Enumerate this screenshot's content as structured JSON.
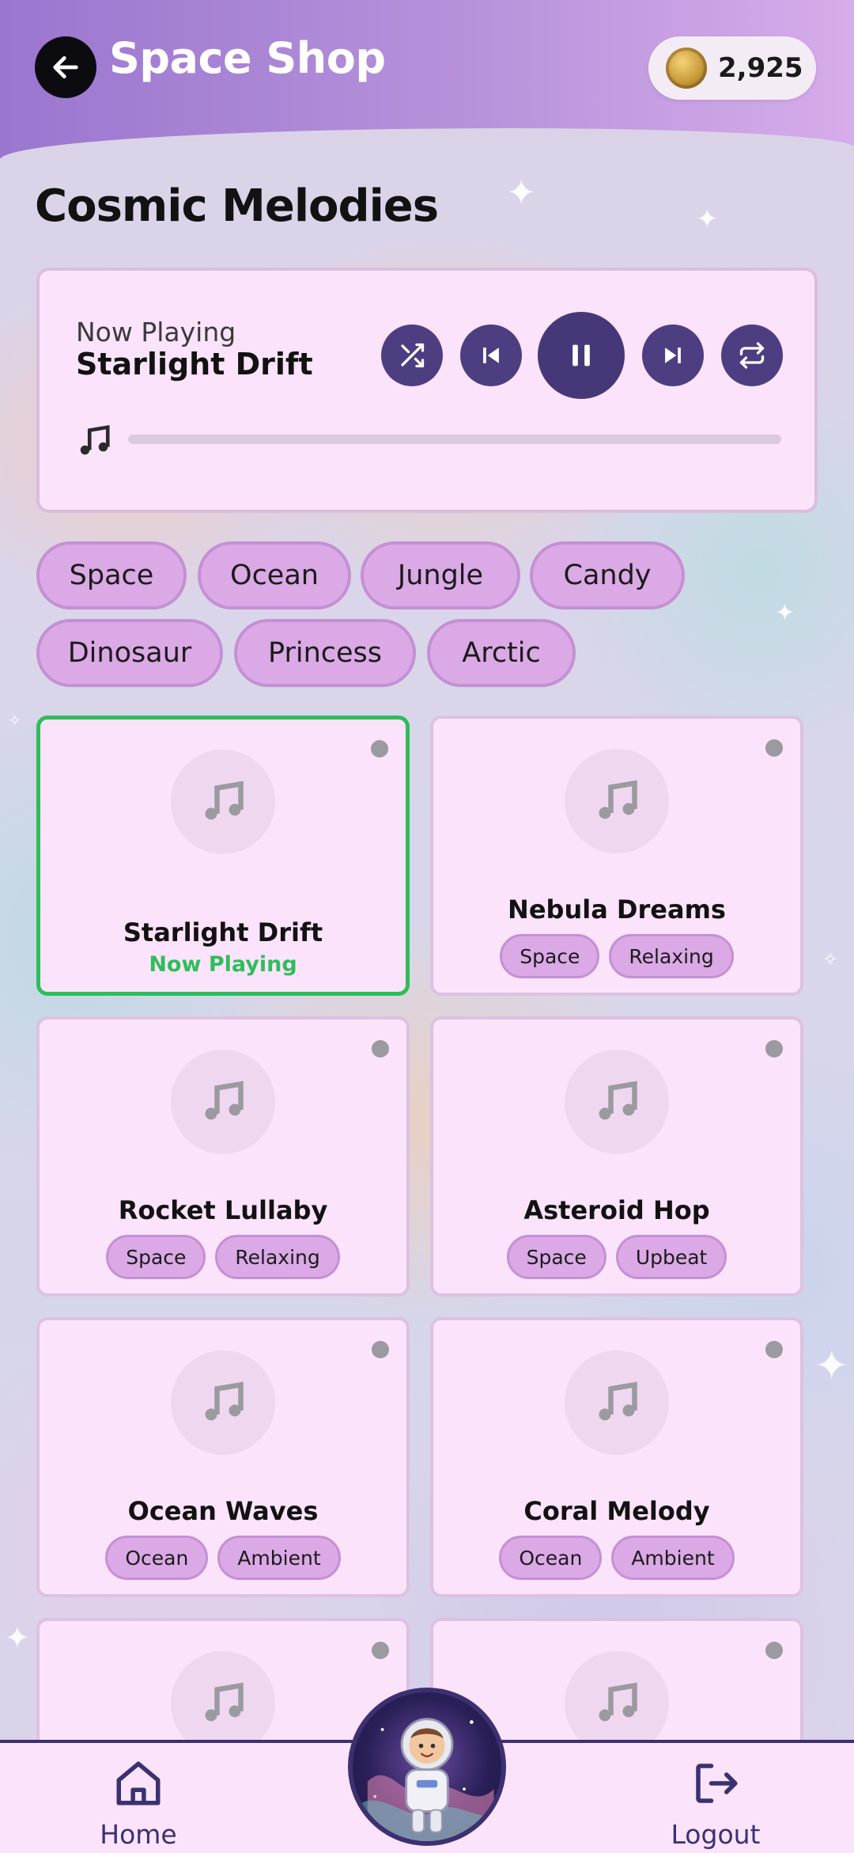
{
  "header": {
    "title": "Space Shop",
    "coins": "2,925"
  },
  "section_title": "Cosmic Melodies",
  "player": {
    "now_playing_label": "Now Playing",
    "track_title": "Starlight Drift",
    "progress": 0.0
  },
  "categories": [
    "Space",
    "Ocean",
    "Jungle",
    "Candy",
    "Dinosaur",
    "Princess",
    "Arctic"
  ],
  "tracks": [
    {
      "title": "Starlight Drift",
      "status": "Now Playing",
      "tags": []
    },
    {
      "title": "Nebula Dreams",
      "tags": [
        "Space",
        "Relaxing"
      ]
    },
    {
      "title": "Rocket Lullaby",
      "tags": [
        "Space",
        "Relaxing"
      ]
    },
    {
      "title": "Asteroid Hop",
      "tags": [
        "Space",
        "Upbeat"
      ]
    },
    {
      "title": "Ocean Waves",
      "tags": [
        "Ocean",
        "Ambient"
      ]
    },
    {
      "title": "Coral Melody",
      "tags": [
        "Ocean",
        "Ambient"
      ]
    }
  ],
  "bottom_nav": {
    "home_label": "Home",
    "logout_label": "Logout"
  },
  "colors": {
    "accent": "#4d3e82",
    "chip": "#dba9e6",
    "card": "#fbe3fb",
    "playing": "#2fbd5a"
  },
  "icons": [
    "back-arrow-icon",
    "coin-icon",
    "shuffle-icon",
    "previous-icon",
    "pause-icon",
    "next-icon",
    "repeat-icon",
    "music-note-icon",
    "home-icon",
    "logout-icon"
  ]
}
